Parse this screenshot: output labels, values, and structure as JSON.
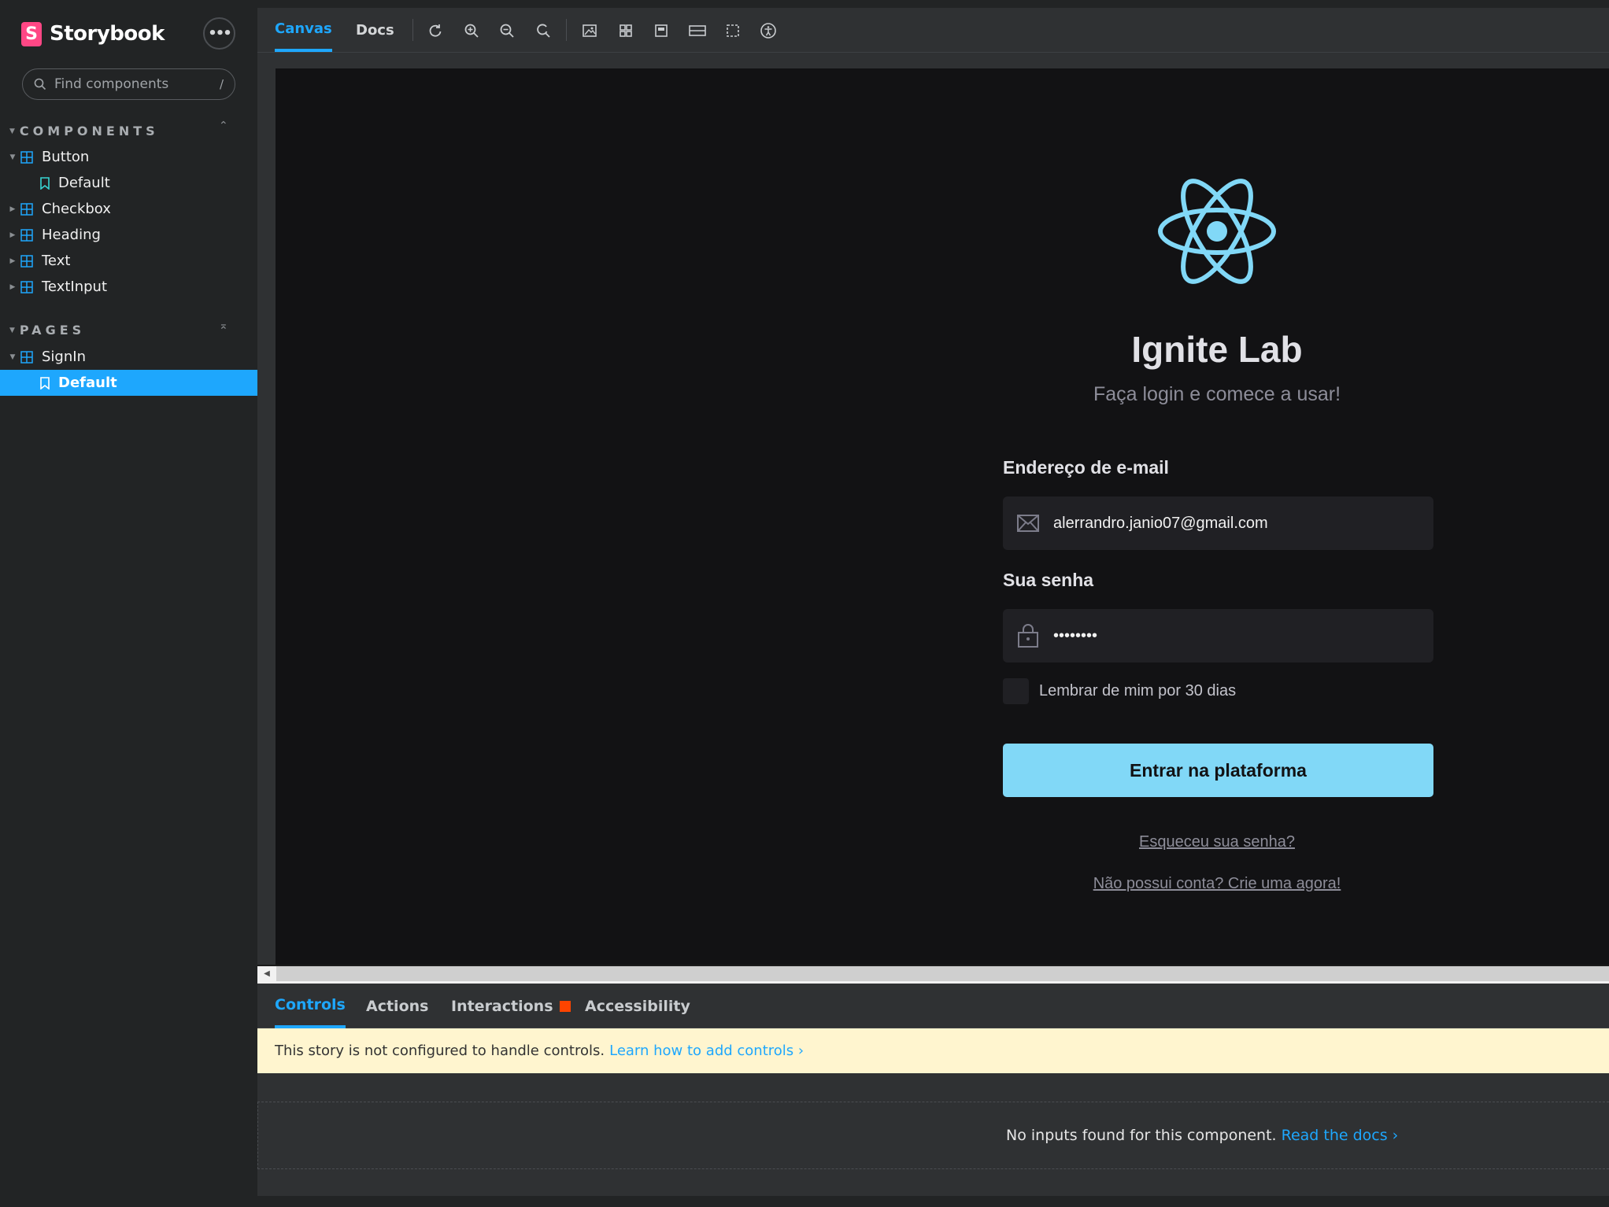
{
  "sidebar": {
    "brand": "Storybook",
    "brand_logo_letter": "S",
    "menu_label": "•••",
    "search": {
      "placeholder": "Find components",
      "shortcut": "/"
    },
    "sections": [
      {
        "title": "COMPONENTS",
        "items": [
          {
            "label": "Button",
            "stories": [
              "Default"
            ]
          },
          {
            "label": "Checkbox"
          },
          {
            "label": "Heading"
          },
          {
            "label": "Text"
          },
          {
            "label": "TextInput"
          }
        ]
      },
      {
        "title": "PAGES",
        "items": [
          {
            "label": "SignIn",
            "stories": [
              "Default"
            ]
          }
        ]
      }
    ],
    "selected_story": "SignIn / Default"
  },
  "toolbar": {
    "tabs": [
      "Canvas",
      "Docs"
    ],
    "active_tab": "Canvas",
    "tools": [
      "reload-icon",
      "zoom-in-icon",
      "zoom-out-icon",
      "zoom-reset-icon",
      "background-icon",
      "grid-icon",
      "viewport-icon",
      "measure-icon",
      "outline-icon",
      "accessibility-icon"
    ]
  },
  "story": {
    "title": "Ignite Lab",
    "subtitle": "Faça login e comece a usar!",
    "email_label": "Endereço de e-mail",
    "email_value": "alerrandro.janio07@gmail.com",
    "password_label": "Sua senha",
    "password_value": "••••••••",
    "remember_label": "Lembrar de mim por 30 dias",
    "submit_label": "Entrar na plataforma",
    "forgot_link": "Esqueceu sua senha?",
    "signup_link": "Não possui conta? Crie uma agora!"
  },
  "panel": {
    "tabs": [
      "Controls",
      "Actions",
      "Interactions",
      "Accessibility"
    ],
    "active_tab": "Controls",
    "notice_text": "This story is not configured to handle controls.",
    "notice_link": "Learn how to add controls ›",
    "empty_text": "No inputs found for this component.",
    "empty_link": "Read the docs ›"
  },
  "colors": {
    "accent": "#1ea7fd",
    "react_cyan": "#81d8f7",
    "badge": "#ff4400",
    "brand_pink": "#ff4785"
  }
}
